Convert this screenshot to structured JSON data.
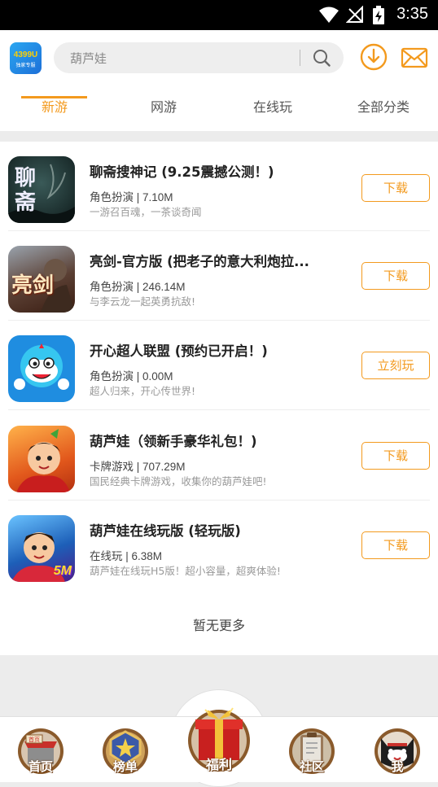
{
  "status": {
    "time": "3:35"
  },
  "search": {
    "placeholder": "葫芦娃"
  },
  "logo": {
    "text": "4399U",
    "subtext": "独家专服"
  },
  "tabs": [
    {
      "label": "新游",
      "active": true
    },
    {
      "label": "网游",
      "active": false
    },
    {
      "label": "在线玩",
      "active": false
    },
    {
      "label": "全部分类",
      "active": false
    }
  ],
  "games": [
    {
      "title": "聊斋搜神记 (9.25震撼公测！)",
      "category": "角色扮演",
      "size": "7.10M",
      "meta": "角色扮演 | 7.10M",
      "desc": "一游召百魂，一茶谈奇闻",
      "button": "下载",
      "icon_text": "聊斋"
    },
    {
      "title": "亮剑-官方版 (把老子的意大利炮拉...",
      "category": "角色扮演",
      "size": "246.14M",
      "meta": "角色扮演 | 246.14M",
      "desc": "与李云龙一起英勇抗敌!",
      "button": "下载",
      "icon_text": "亮剑"
    },
    {
      "title": "开心超人联盟 (预约已开启！)",
      "category": "角色扮演",
      "size": "0.00M",
      "meta": "角色扮演 | 0.00M",
      "desc": "超人归来，开心传世界!",
      "button": "立刻玩",
      "icon_text": ""
    },
    {
      "title": "葫芦娃（领新手豪华礼包！)",
      "category": "卡牌游戏",
      "size": "707.29M",
      "meta": "卡牌游戏 | 707.29M",
      "desc": "国民经典卡牌游戏，收集你的葫芦娃吧!",
      "button": "下载",
      "icon_text": ""
    },
    {
      "title": "葫芦娃在线玩版 (轻玩版)",
      "category": "在线玩",
      "size": "6.38M",
      "meta": "在线玩 | 6.38M",
      "desc": "葫芦娃在线玩H5版！超小容量，超爽体验!",
      "button": "下载",
      "icon_text": "5M"
    }
  ],
  "list_footer": "暂无更多",
  "nav": [
    {
      "label": "首页",
      "icon": "shop-icon",
      "sign": "首页"
    },
    {
      "label": "榜单",
      "icon": "badge-icon"
    },
    {
      "label": "福利",
      "icon": "gift-icon"
    },
    {
      "label": "社区",
      "icon": "clipboard-icon"
    },
    {
      "label": "我",
      "icon": "cat-avatar-icon"
    }
  ],
  "colors": {
    "accent": "#f39a1e",
    "status_bar": "#000000"
  }
}
